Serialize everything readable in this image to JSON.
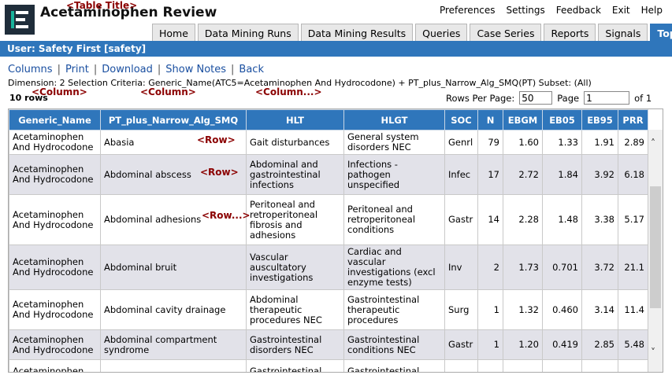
{
  "app": {
    "title": "Acetaminophen Review"
  },
  "annotations": {
    "table_title": "<Table Title>",
    "column1": "<Column>",
    "column2": "<Column>",
    "column3": "<Column...>",
    "row1": "<Row>",
    "row2": "<Row>",
    "row3": "<Row...>"
  },
  "topnav": [
    "Preferences",
    "Settings",
    "Feedback",
    "Exit",
    "Help"
  ],
  "tabs": [
    {
      "label": "Home",
      "active": false
    },
    {
      "label": "Data Mining Runs",
      "active": false
    },
    {
      "label": "Data Mining Results",
      "active": false
    },
    {
      "label": "Queries",
      "active": false
    },
    {
      "label": "Case Series",
      "active": false
    },
    {
      "label": "Reports",
      "active": false
    },
    {
      "label": "Signals",
      "active": false
    },
    {
      "label": "Topics",
      "active": true
    }
  ],
  "user_bar": "User: Safety First [safety]",
  "links": [
    "Columns",
    "Print",
    "Download",
    "Show Notes",
    "Back"
  ],
  "dimension_text": "Dimension: 2 Selection Criteria: Generic_Name(ATC5=Acetaminophen And Hydrocodone) + PT_plus_Narrow_Alg_SMQ(PT) Subset: (All)",
  "row_count": "10 rows",
  "pagination": {
    "rows_per_page_label": "Rows Per Page:",
    "rows_per_page": "50",
    "page_label": "Page",
    "page": "1",
    "of_label": "of 1"
  },
  "columns": [
    "Generic_Name",
    "PT_plus_Narrow_Alg_SMQ",
    "HLT",
    "HLGT",
    "SOC",
    "N",
    "EBGM",
    "EB05",
    "EB95",
    "PRR"
  ],
  "rows": [
    [
      "Acetaminophen And Hydrocodone",
      "Abasia",
      "Gait disturbances",
      "General system disorders NEC",
      "Genrl",
      "79",
      "1.60",
      "1.33",
      "1.91",
      "2.89"
    ],
    [
      "Acetaminophen And Hydrocodone",
      "Abdominal abscess",
      "Abdominal and gastrointestinal infections",
      "Infections - pathogen unspecified",
      "Infec",
      "17",
      "2.72",
      "1.84",
      "3.92",
      "6.18"
    ],
    [
      "Acetaminophen And Hydrocodone",
      "Abdominal adhesions",
      "Peritoneal and retroperitoneal fibrosis and adhesions",
      "Peritoneal and retroperitoneal conditions",
      "Gastr",
      "14",
      "2.28",
      "1.48",
      "3.38",
      "5.17"
    ],
    [
      "Acetaminophen And Hydrocodone",
      "Abdominal bruit",
      "Vascular auscultatory investigations",
      "Cardiac and vascular investigations (excl enzyme tests)",
      "Inv",
      "2",
      "1.73",
      "0.701",
      "3.72",
      "21.1"
    ],
    [
      "Acetaminophen And Hydrocodone",
      "Abdominal cavity drainage",
      "Abdominal therapeutic procedures NEC",
      "Gastrointestinal therapeutic procedures",
      "Surg",
      "1",
      "1.32",
      "0.460",
      "3.14",
      "11.4"
    ],
    [
      "Acetaminophen And Hydrocodone",
      "Abdominal compartment syndrome",
      "Gastrointestinal disorders NEC",
      "Gastrointestinal conditions NEC",
      "Gastr",
      "1",
      "1.20",
      "0.419",
      "2.85",
      "5.48"
    ],
    [
      "Acetaminophen",
      "",
      "Gastrointestinal",
      "Gastrointestinal",
      "",
      "",
      "",
      "",
      "",
      ""
    ]
  ]
}
